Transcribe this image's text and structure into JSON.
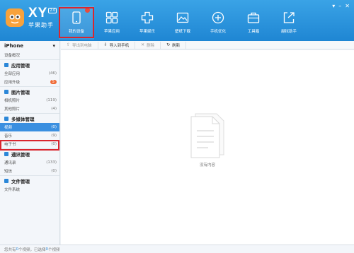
{
  "brand": {
    "name": "XY",
    "version": "2.0",
    "subtitle": "苹果助手"
  },
  "nav": [
    {
      "label": "我的设备",
      "icon": "device-icon"
    },
    {
      "label": "苹果应用",
      "icon": "apps-icon"
    },
    {
      "label": "苹果娱乐",
      "icon": "entertainment-icon"
    },
    {
      "label": "壁纸下载",
      "icon": "wallpaper-icon"
    },
    {
      "label": "手机优化",
      "icon": "optimize-icon"
    },
    {
      "label": "工具箱",
      "icon": "toolbox-icon"
    },
    {
      "label": "越狱助手",
      "icon": "jailbreak-icon"
    }
  ],
  "sidebar": {
    "device": {
      "name": "iPhone",
      "overview": "设备概况"
    },
    "sections": [
      {
        "title": "应用管理",
        "items": [
          {
            "label": "全部应用",
            "count": "(46)"
          },
          {
            "label": "应用升级",
            "count": "5"
          }
        ]
      },
      {
        "title": "图片管理",
        "items": [
          {
            "label": "相机照片",
            "count": "(119)"
          },
          {
            "label": "其他照片",
            "count": "(4)"
          }
        ]
      },
      {
        "title": "多媒体管理",
        "items": [
          {
            "label": "视频",
            "count": "(0)"
          },
          {
            "label": "音乐",
            "count": "(9)"
          },
          {
            "label": "电子书",
            "count": "(0)"
          }
        ]
      },
      {
        "title": "通讯管理",
        "items": [
          {
            "label": "通讯录",
            "count": "(133)"
          },
          {
            "label": "短信",
            "count": "(0)"
          }
        ]
      },
      {
        "title": "文件管理",
        "items": [
          {
            "label": "文件系统",
            "count": ""
          }
        ]
      }
    ]
  },
  "toolbar": {
    "export": "导出到电脑",
    "import": "导入到手机",
    "delete": "删除",
    "refresh": "刷新"
  },
  "main": {
    "empty_text": "没有内容"
  },
  "status": {
    "prefix": "您共有",
    "total": "0",
    "mid": "个视频，已选择",
    "selected": "0",
    "suffix": "个视频"
  }
}
